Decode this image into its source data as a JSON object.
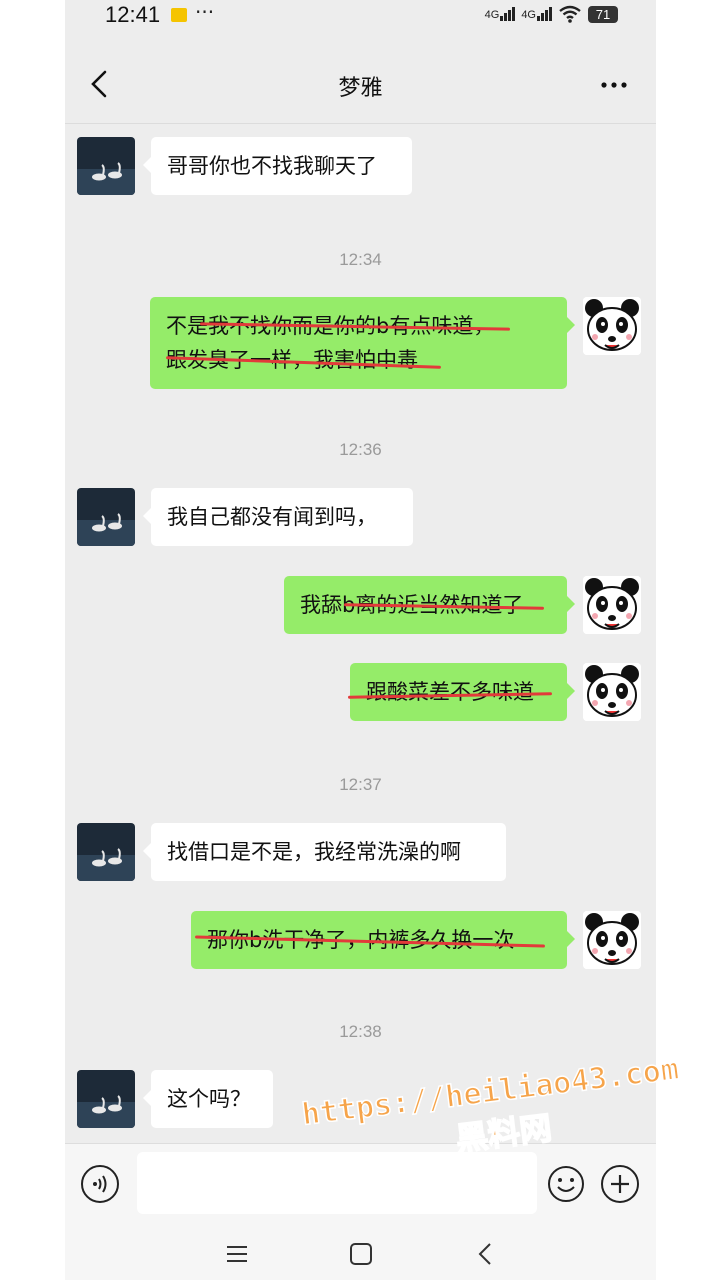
{
  "status_bar": {
    "time": "12:41",
    "network_1": "4G",
    "network_2": "4G",
    "battery": "71"
  },
  "header": {
    "title": "梦雅",
    "back_icon": "chevron-left-icon",
    "more_icon": "more-horizontal-icon"
  },
  "messages": [
    {
      "type": "incoming",
      "text": "哥哥你也不找我聊天了"
    },
    {
      "type": "timestamp",
      "text": "12:34"
    },
    {
      "type": "outgoing",
      "lines": [
        "不是我不找你而是你的b有点味道，",
        "跟发臭了一样，我害怕中毒"
      ],
      "struck": true
    },
    {
      "type": "timestamp",
      "text": "12:36"
    },
    {
      "type": "incoming",
      "text": "我自己都没有闻到吗，"
    },
    {
      "type": "outgoing",
      "text": "我舔b离的近当然知道了",
      "struck": true
    },
    {
      "type": "outgoing",
      "text": "跟酸菜差不多味道",
      "struck": true
    },
    {
      "type": "timestamp",
      "text": "12:37"
    },
    {
      "type": "incoming",
      "text": "找借口是不是，我经常洗澡的啊"
    },
    {
      "type": "outgoing",
      "text": "那你b洗干净了，内裤多久换一次",
      "struck": true
    },
    {
      "type": "timestamp",
      "text": "12:38"
    },
    {
      "type": "incoming",
      "text": "这个吗？"
    }
  ],
  "input_bar": {
    "voice_icon": "voice-icon",
    "message_value": "",
    "emoji_icon": "emoji-icon",
    "plus_icon": "plus-circle-icon"
  },
  "nav_bar": {
    "icons": [
      "menu-icon",
      "home-square-icon",
      "back-triangle-icon"
    ]
  },
  "watermark": {
    "url": "https://heiliao43.com",
    "name": "黑料网"
  },
  "colors": {
    "background": "#ededed",
    "outgoing_bubble": "#95ec69",
    "incoming_bubble": "#ffffff",
    "strike": "#e23a3a",
    "watermark": "#f6a44a"
  }
}
